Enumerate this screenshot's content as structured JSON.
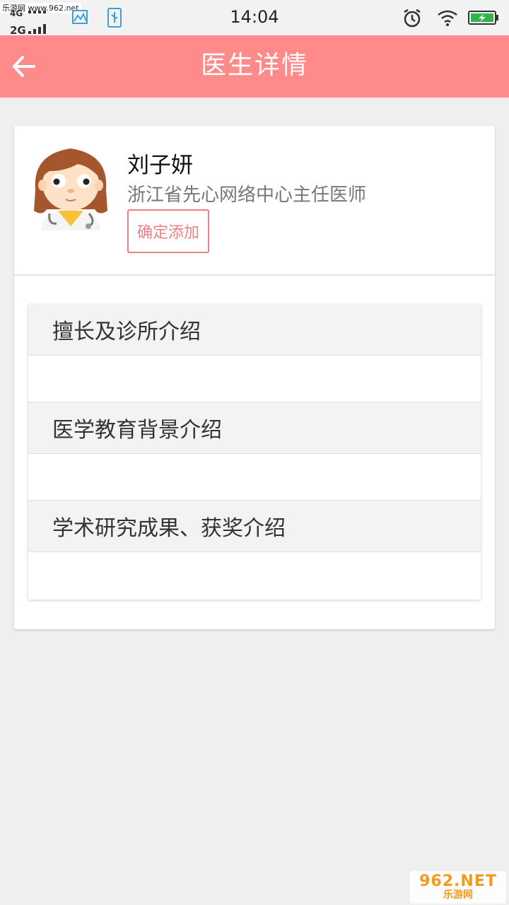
{
  "status_bar": {
    "watermark": "乐游网 www.962.net",
    "network_top": "4G",
    "network_bottom": "2G",
    "time": "14:04"
  },
  "app_bar": {
    "title": "医生详情",
    "background_color": "#ff8a8a"
  },
  "doctor": {
    "name": "刘子妍",
    "title": "浙江省先心网络中心主任医师",
    "add_button_label": "确定添加",
    "accent_color": "#ef7f85"
  },
  "sections": [
    {
      "heading": "擅长及诊所介绍",
      "content": ""
    },
    {
      "heading": "医学教育背景介绍",
      "content": ""
    },
    {
      "heading": "学术研究成果、获奖介绍",
      "content": ""
    }
  ],
  "watermark_bottom": {
    "main": "962.NET",
    "sub": "乐游网"
  }
}
